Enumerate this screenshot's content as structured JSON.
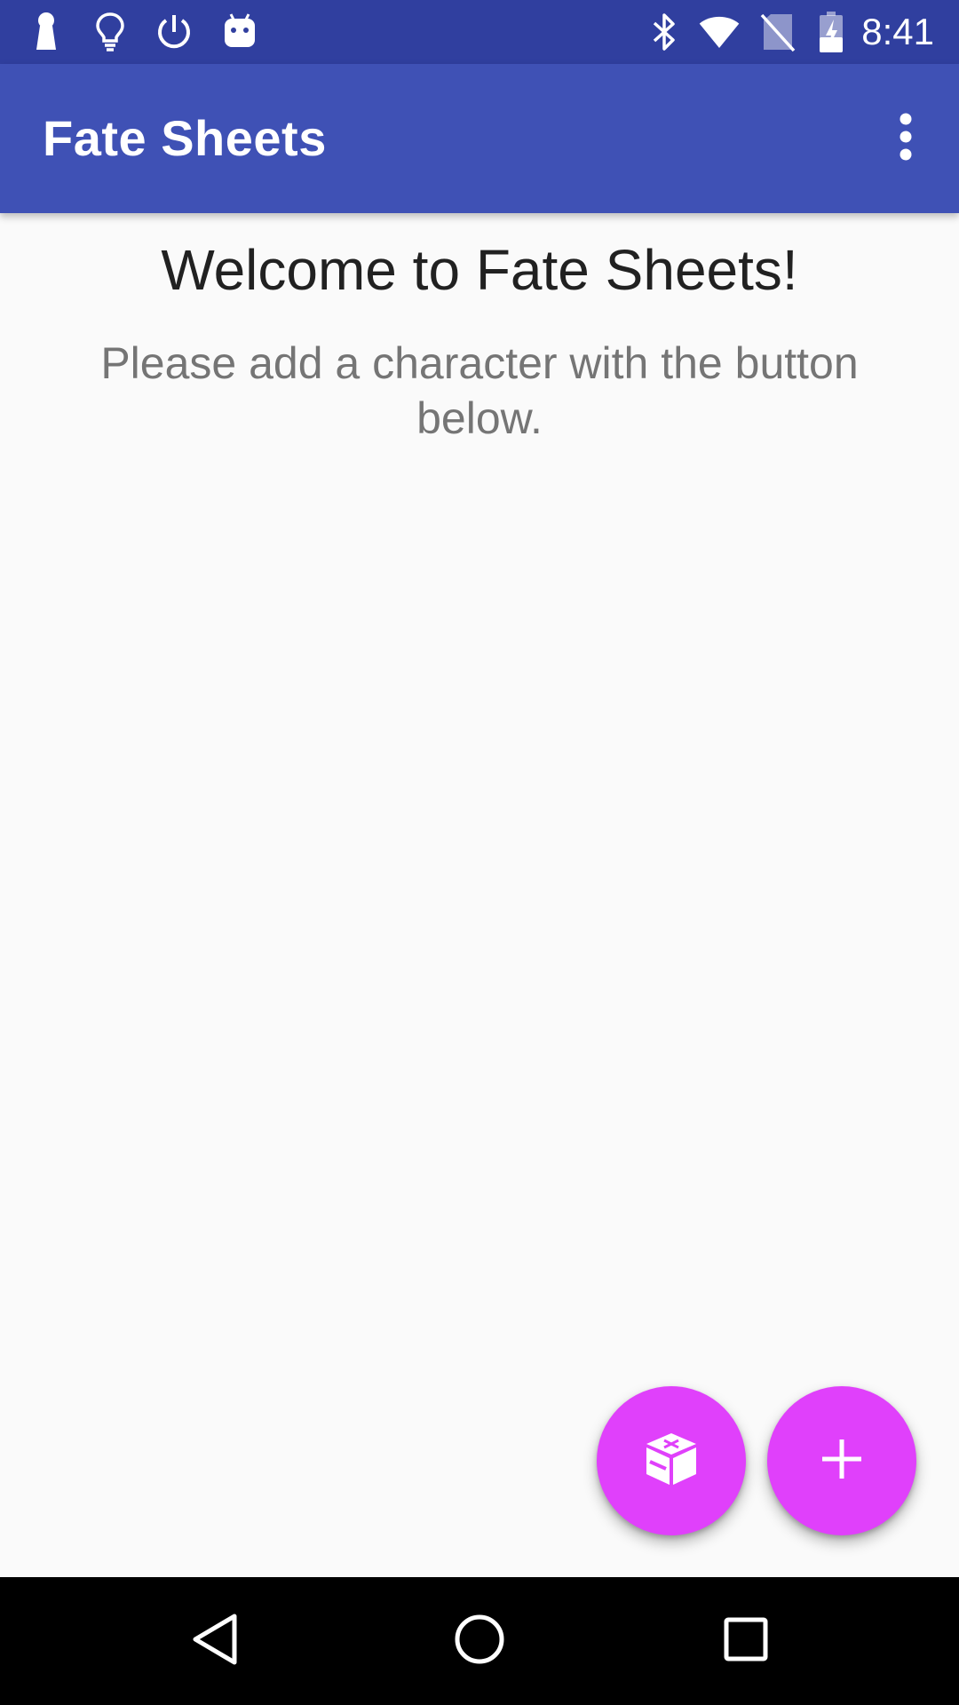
{
  "status_bar": {
    "time": "8:41",
    "left_icons": [
      "keyhole-icon",
      "lightbulb-icon",
      "power-icon",
      "android-icon"
    ],
    "right_icons": [
      "bluetooth-icon",
      "wifi-icon",
      "no-sim-icon",
      "battery-charging-icon"
    ]
  },
  "app_bar": {
    "title": "Fate Sheets",
    "overflow_icon": "more-vert-icon"
  },
  "main": {
    "welcome_title": "Welcome to Fate Sheets!",
    "welcome_message": "Please add a character with the button below."
  },
  "fabs": {
    "dice_icon": "dice-icon",
    "add_icon": "add-icon"
  },
  "nav_bar": {
    "icons": [
      "back-icon",
      "home-icon",
      "recents-icon"
    ]
  },
  "colors": {
    "status_bar": "#303f9f",
    "app_bar": "#3f51b5",
    "fab": "#e040fb",
    "background": "#fafafa"
  }
}
